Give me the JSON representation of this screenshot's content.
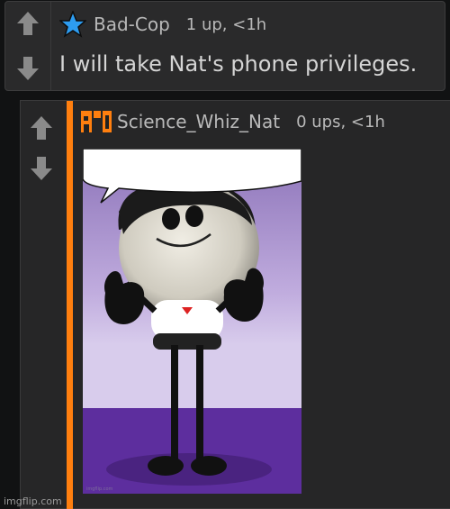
{
  "comments": [
    {
      "username": "Bad-Cop",
      "points": "1 up, <1h",
      "text": "I will take Nat's phone privileges.",
      "user_icon": "star-icon"
    },
    {
      "username": "Science_Whiz_Nat",
      "points": "0 ups, <1h",
      "user_icon": "flash-icon",
      "image": "meme-image"
    }
  ],
  "colors": {
    "accent_orange": "#ff7f0f",
    "star_blue": "#2d9cf0",
    "background": "#111213",
    "panel": "#2a2a2b"
  },
  "watermark": "imgflip.com",
  "image_watermark": "imgflip.com"
}
